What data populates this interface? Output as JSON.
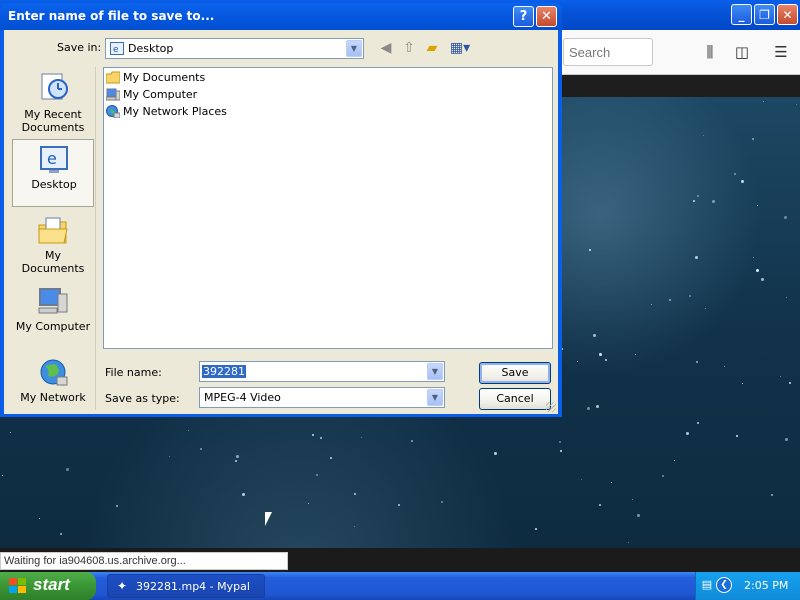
{
  "browser": {
    "search_placeholder": "Search",
    "status_text": "Waiting for ia904608.us.archive.org...",
    "toolbar_icons": [
      "library-icon",
      "sidebar-icon",
      "menu-icon"
    ]
  },
  "dialog": {
    "title": "Enter name of file to save to...",
    "save_in_label": "Save in:",
    "save_in_value": "Desktop",
    "places": [
      {
        "label": "My Recent\nDocuments",
        "icon": "recent-documents-icon"
      },
      {
        "label": "Desktop",
        "icon": "desktop-icon"
      },
      {
        "label": "My Documents",
        "icon": "my-documents-icon"
      },
      {
        "label": "My Computer",
        "icon": "my-computer-icon"
      },
      {
        "label": "My Network",
        "icon": "my-network-icon"
      }
    ],
    "files": [
      {
        "name": "My Documents",
        "icon": "folder-icon"
      },
      {
        "name": "My Computer",
        "icon": "computer-icon"
      },
      {
        "name": "My Network Places",
        "icon": "network-icon"
      }
    ],
    "file_name_label": "File name:",
    "file_name_value": "392281",
    "save_as_type_label": "Save as type:",
    "save_as_type_value": "MPEG-4 Video",
    "save_button": "Save",
    "cancel_button": "Cancel",
    "help_button": "?",
    "close_button": "✕"
  },
  "taskbar": {
    "start_label": "start",
    "task_label": "392281.mp4 - Mypal",
    "clock": "2:05 PM"
  },
  "colors": {
    "title_bar": "#0a5ee8",
    "dialog_body": "#ece9d8",
    "selection": "#316ac5",
    "taskbar": "#245edb",
    "start_button": "#3a9634"
  }
}
